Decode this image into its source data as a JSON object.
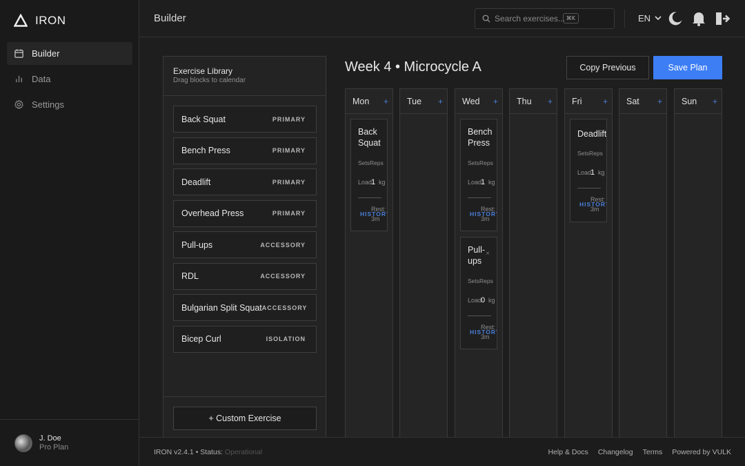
{
  "brand": {
    "name": "IRON"
  },
  "sidebar": {
    "items": [
      {
        "label": "Builder",
        "icon": "calendar-icon"
      },
      {
        "label": "Data",
        "icon": "bar-chart-icon"
      },
      {
        "label": "Settings",
        "icon": "gear-icon"
      }
    ],
    "user": {
      "name": "J. Doe",
      "plan": "Pro Plan"
    }
  },
  "header": {
    "title": "Builder",
    "search_placeholder": "Search exercises...",
    "search_shortcut": "⌘K",
    "language": "EN"
  },
  "library": {
    "title": "Exercise Library",
    "subtitle": "Drag blocks to calendar",
    "items": [
      {
        "name": "Back Squat",
        "tag": "PRIMARY"
      },
      {
        "name": "Bench Press",
        "tag": "PRIMARY"
      },
      {
        "name": "Deadlift",
        "tag": "PRIMARY"
      },
      {
        "name": "Overhead Press",
        "tag": "PRIMARY"
      },
      {
        "name": "Pull-ups",
        "tag": "ACCESSORY"
      },
      {
        "name": "RDL",
        "tag": "ACCESSORY"
      },
      {
        "name": "Bulgarian Split Squat",
        "tag": "ACCESSORY"
      },
      {
        "name": "Bicep Curl",
        "tag": "ISOLATION"
      }
    ],
    "custom_button": "+ Custom Exercise"
  },
  "planner": {
    "title": "Week 4 • Microcycle A",
    "copy_button": "Copy Previous",
    "save_button": "Save Plan",
    "add_symbol": "+",
    "days": [
      "Mon",
      "Tue",
      "Wed",
      "Thu",
      "Fri",
      "Sat",
      "Sun"
    ],
    "block_labels": {
      "sets": "Sets",
      "reps": "Reps",
      "load": "Load",
      "unit": "kg",
      "rest": "Rest:",
      "history": "HISTORY",
      "remove": "×"
    },
    "blocks": [
      {
        "day": "Mon",
        "name": "Back Squat",
        "load": "1",
        "rest": "3m"
      },
      {
        "day": "Wed",
        "name": "Bench Press",
        "load": "1",
        "rest": "3m"
      },
      {
        "day": "Wed",
        "name": "Pull-ups",
        "load": "0",
        "rest": "3m"
      },
      {
        "day": "Fri",
        "name": "Deadlift",
        "load": "1",
        "rest": "3m"
      }
    ]
  },
  "footer": {
    "version": "IRON v2.4.1",
    "status_label": "Status:",
    "status_value": "Operational",
    "links": [
      "Help & Docs",
      "Changelog",
      "Terms",
      "Powered by VULK"
    ]
  },
  "colors": {
    "accent": "#3d7ef5",
    "link": "#4a7fd8",
    "background": "#1e1e1e"
  }
}
